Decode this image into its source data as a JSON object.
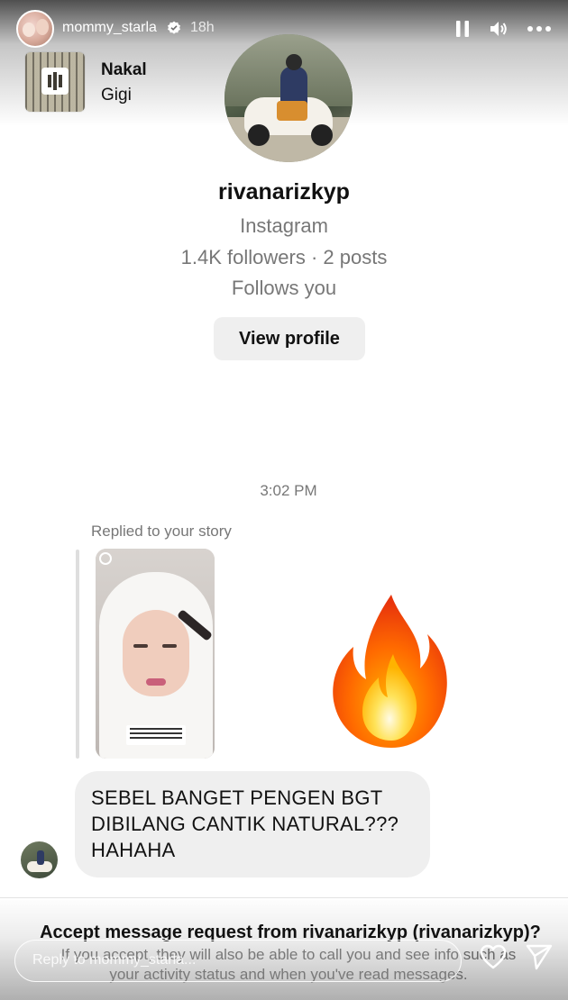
{
  "story": {
    "username": "mommy_starla",
    "time_ago": "18h",
    "icons": [
      "verified-icon",
      "pause-icon",
      "volume-icon",
      "more-icon"
    ]
  },
  "music": {
    "title": "Nakal",
    "artist": "Gigi"
  },
  "profile": {
    "name": "rivanarizkyp",
    "platform": "Instagram",
    "stats": "1.4K followers · 2 posts",
    "follow_status": "Follows you",
    "view_profile_label": "View profile"
  },
  "conversation": {
    "timestamp": "3:02 PM",
    "replied_label": "Replied to your story",
    "reaction_emoji": "fire",
    "message": "SEBEL BANGET PENGEN BGT\nDIBILANG CANTIK NATURAL???\nHAHAHA"
  },
  "request": {
    "title": "Accept message request from rivanarizkyp (rivanarizkyp)?",
    "description": "If you accept, they will also be able to call you and see info such as\nyour activity status and when you've read messages."
  },
  "reply_bar": {
    "placeholder": "Reply to mommy_starla..."
  },
  "colors": {
    "bubble": "#efefef",
    "secondary_text": "#777777",
    "button_bg": "#efefef"
  }
}
